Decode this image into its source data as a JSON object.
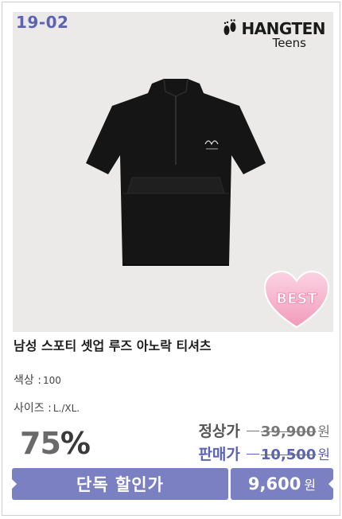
{
  "product_code": "19-02",
  "brand": {
    "name": "HANGTEN",
    "sub": "Teens"
  },
  "badge": "BEST",
  "title": "남성 스포티 셋업 루즈 아노락 티셔츠",
  "options": {
    "color_label": "색상 :",
    "color_value": "100",
    "size_label": "사이즈 :",
    "size_value": "L./XL."
  },
  "discount": {
    "value": "75",
    "unit": "%"
  },
  "prices": {
    "regular_label": "정상가",
    "regular_value": "39,900",
    "sale_label": "판매가",
    "sale_value": "10,500",
    "currency": "원"
  },
  "banner": {
    "label": "단독 할인가",
    "price": "9,600",
    "currency": "원"
  },
  "colors": {
    "accent": "#7b80c3",
    "code": "#5d63b4",
    "photo_bg": "#ebeae8",
    "badge_pink": "#f4a3c2"
  },
  "icons": [
    "footprints-logo-icon",
    "shirt-image",
    "heart-best-badge-icon"
  ]
}
